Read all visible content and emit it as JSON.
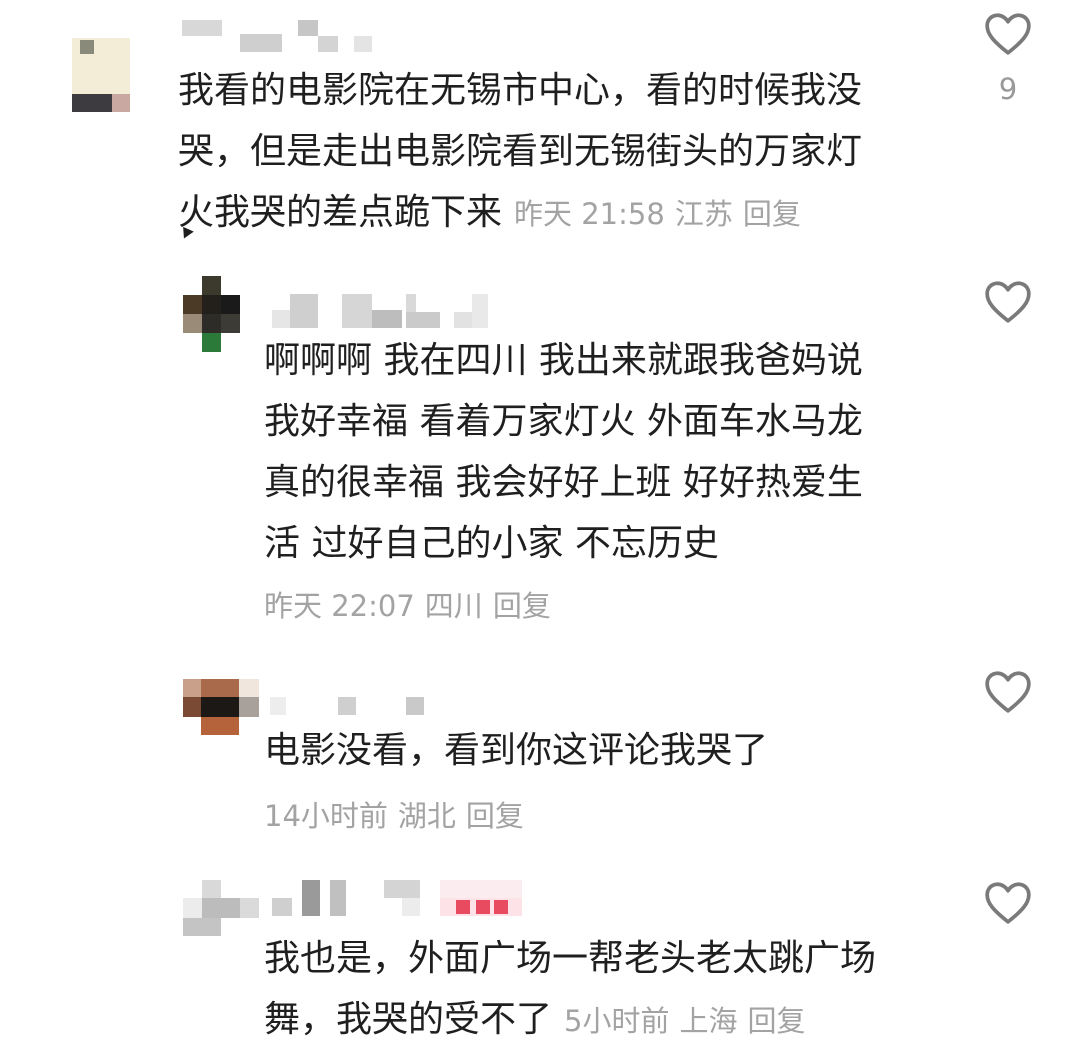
{
  "comments": [
    {
      "lines": [
        "我看的电影院在无锡市中心，看的时候我没",
        "哭，但是走出电影院看到无锡街头的万家灯",
        "火我哭的差点跪下来"
      ],
      "time": "昨天 21:58",
      "location": "江苏",
      "reply_label": "回复",
      "likes": "9"
    },
    {
      "lines": [
        "啊啊啊 我在四川 我出来就跟我爸妈说",
        "我好幸福 看着万家灯火 外面车水马龙",
        "真的很幸福 我会好好上班 好好热爱生",
        "活 过好自己的小家 不忘历史"
      ],
      "time": "昨天 22:07",
      "location": "四川",
      "reply_label": "回复"
    },
    {
      "lines": [
        "电影没看，看到你这评论我哭了"
      ],
      "time": "14小时前",
      "location": "湖北",
      "reply_label": "回复"
    },
    {
      "lines": [
        "我也是，外面广场一帮老头老太跳广场",
        "舞，我哭的受不了"
      ],
      "time": "5小时前",
      "location": "上海",
      "reply_label": "回复"
    }
  ],
  "icons": {
    "like": "heart-outline-icon"
  },
  "colors": {
    "text": "#1f1f1f",
    "meta": "#a3a3a3",
    "icon": "#7a7a7a"
  }
}
